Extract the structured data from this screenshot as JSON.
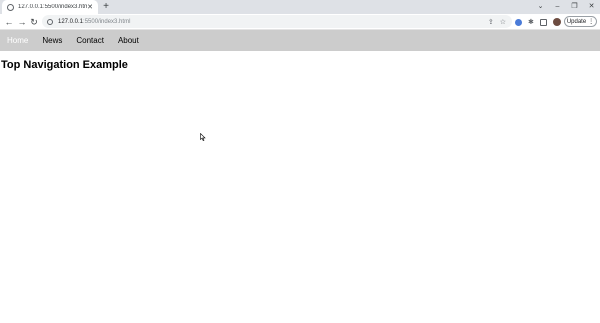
{
  "browser": {
    "tab_title": "127.0.0.1:5500/index3.html",
    "tab_close": "✕",
    "new_tab": "+",
    "url_host": "127.0.0.1",
    "url_rest": ":5500/index3.html",
    "update_label": "Update",
    "window_controls": {
      "list": "⌄",
      "minimize": "–",
      "restore": "❐",
      "close": "✕"
    },
    "nav": {
      "back": "←",
      "forward": "→",
      "reload": "↻"
    },
    "omni_icons": {
      "share": "⇪",
      "bookmark": "☆"
    },
    "ext_puzzle": "✱",
    "update_menu": "⋮"
  },
  "page": {
    "nav_items": [
      {
        "label": "Home",
        "active": true
      },
      {
        "label": "News",
        "active": false
      },
      {
        "label": "Contact",
        "active": false
      },
      {
        "label": "About",
        "active": false
      }
    ],
    "title": "Top Navigation Example"
  }
}
